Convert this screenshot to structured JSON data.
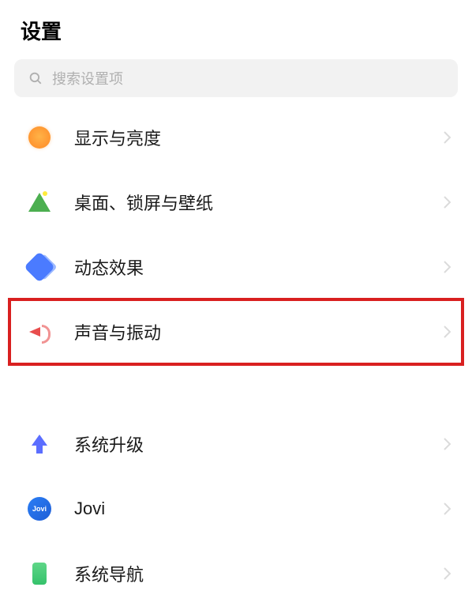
{
  "page": {
    "title": "设置"
  },
  "search": {
    "placeholder": "搜索设置项"
  },
  "items": {
    "display": {
      "label": "显示与亮度"
    },
    "desktop": {
      "label": "桌面、锁屏与壁纸"
    },
    "effects": {
      "label": "动态效果"
    },
    "sound": {
      "label": "声音与振动"
    },
    "upgrade": {
      "label": "系统升级"
    },
    "jovi": {
      "label": "Jovi",
      "badge": "Jovi"
    },
    "nav": {
      "label": "系统导航"
    }
  }
}
